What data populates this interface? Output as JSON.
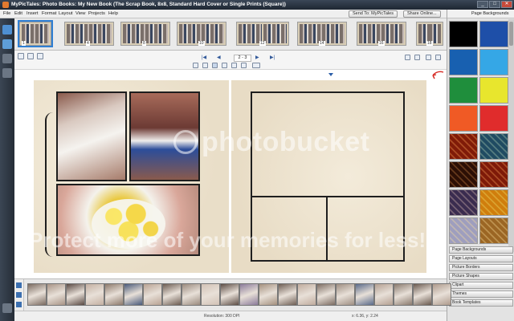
{
  "window": {
    "title": "MyPicTales: Photo Books: My New Book (The Scrap Book, 8x8, Standard Hard Cover or Single Prints (Square))",
    "minimize": "_",
    "maximize": "□",
    "close": "✕"
  },
  "menu": {
    "items": [
      "File",
      "Edit",
      "Insert",
      "Format",
      "Layout",
      "View",
      "Projects",
      "Help"
    ],
    "send_label": "Send To: MyPicTales",
    "share_label": "Share Online..."
  },
  "top_strip": {
    "spreads": [
      {
        "num": "1",
        "active": true
      },
      {
        "num": "4",
        "active": false
      },
      {
        "num": "8",
        "active": false
      },
      {
        "num": "10",
        "active": false
      },
      {
        "num": "12",
        "active": false
      },
      {
        "num": "14",
        "active": false
      },
      {
        "num": "16",
        "active": false
      },
      {
        "num": "18",
        "active": false
      }
    ]
  },
  "editor": {
    "page_indicator": "2 - 3",
    "prev_label": "◀",
    "next_label": "▶",
    "first_label": "|◀",
    "last_label": "▶|"
  },
  "watermark": {
    "main": "photobucket",
    "sub": "Protect more of your memories for less!"
  },
  "right_panel": {
    "header": "Page Backgrounds",
    "swatches": [
      {
        "color": "#000000",
        "kind": "solid"
      },
      {
        "color": "#1e4fa8",
        "kind": "solid"
      },
      {
        "color": "#1860b0",
        "kind": "solid"
      },
      {
        "color": "#35a7e6",
        "kind": "solid"
      },
      {
        "color": "#1f8e3c",
        "kind": "solid"
      },
      {
        "color": "#e8e62d",
        "kind": "solid"
      },
      {
        "color": "#f05a25",
        "kind": "solid"
      },
      {
        "color": "#e02c2c",
        "kind": "solid"
      },
      {
        "color": "#b5532c",
        "kind": "pattern"
      },
      {
        "color": "#5a8a9e",
        "kind": "pattern"
      },
      {
        "color": "#6a3e22",
        "kind": "pattern"
      },
      {
        "color": "#b3522e",
        "kind": "pattern"
      },
      {
        "color": "#7a6a8e",
        "kind": "pattern"
      },
      {
        "color": "#e6b33a",
        "kind": "pattern"
      },
      {
        "color": "#c9c9dc",
        "kind": "pattern"
      },
      {
        "color": "#c7a160",
        "kind": "pattern"
      }
    ],
    "accordion": [
      "Page Backgrounds",
      "Page Layouts",
      "Picture Borders",
      "Picture Shapes",
      "Clipart",
      "Themes",
      "Book Templates"
    ]
  },
  "statusbar": {
    "resolution": "Resolution: 300 DPI",
    "coords": "x: 6.36, y: 2.24"
  }
}
